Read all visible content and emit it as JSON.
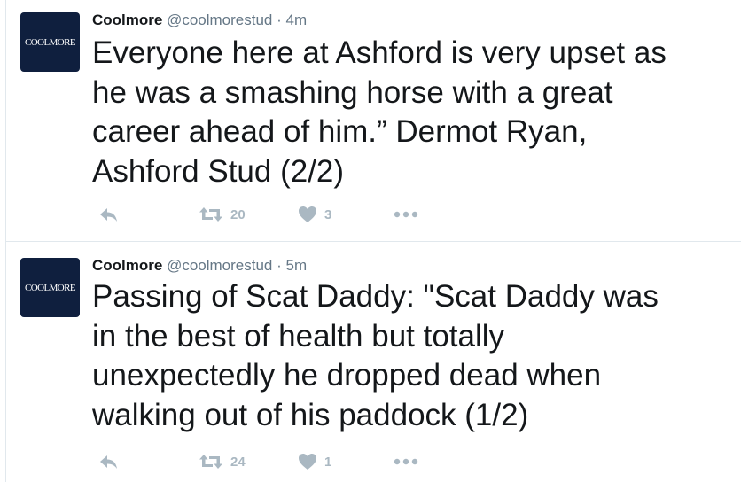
{
  "colors": {
    "avatar_bg": "#0f1f3e",
    "name": "#14171a",
    "meta": "#657786",
    "action_icon": "#aab8c2",
    "divider": "#e1e8ed"
  },
  "tweets": [
    {
      "avatar_text": "COOLMORE",
      "name": "Coolmore",
      "handle": "@coolmorestud",
      "time": "· 4m",
      "text": "Everyone here at Ashford is very upset as\nhe was a smashing horse with a great\ncareer ahead of him.” Dermot Ryan,\nAshford Stud (2/2)",
      "retweets": "20",
      "likes": "3",
      "icons": [
        "reply-icon",
        "retweet-icon",
        "heart-icon",
        "more-icon"
      ]
    },
    {
      "avatar_text": "COOLMORE",
      "name": "Coolmore",
      "handle": "@coolmorestud",
      "time": "· 5m",
      "text": "Passing of Scat Daddy: \"Scat Daddy was\nin the best of health but totally\nunexpectedly he dropped dead when\nwalking out of his paddock (1/2)",
      "retweets": "24",
      "likes": "1",
      "icons": [
        "reply-icon",
        "retweet-icon",
        "heart-icon",
        "more-icon"
      ]
    }
  ]
}
